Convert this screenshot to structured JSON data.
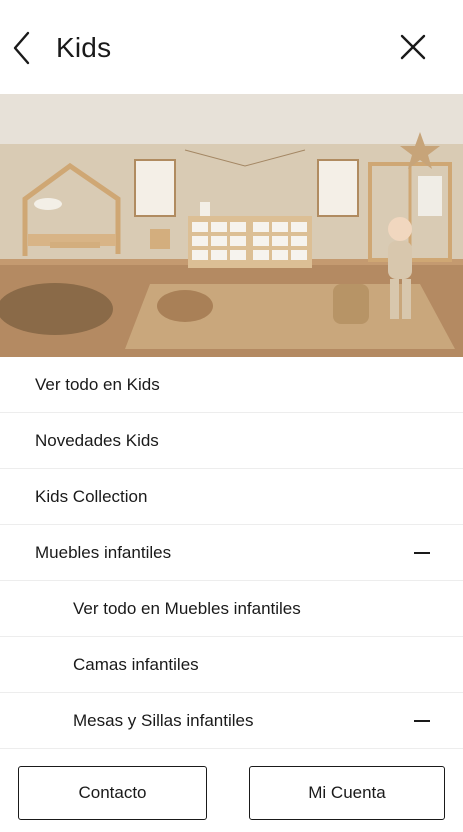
{
  "header": {
    "title": "Kids",
    "back_icon": "chevron-left-icon",
    "close_icon": "close-icon"
  },
  "menu": {
    "items": [
      {
        "label": "Ver todo en Kids",
        "level": 1
      },
      {
        "label": "Novedades Kids",
        "level": 1
      },
      {
        "label": "Kids Collection",
        "level": 1
      },
      {
        "label": "Muebles infantiles",
        "level": 1,
        "toggle": "—"
      },
      {
        "label": "Ver todo en Muebles infantiles",
        "level": 2
      },
      {
        "label": "Camas infantiles",
        "level": 2
      },
      {
        "label": "Mesas y Sillas infantiles",
        "level": 2,
        "toggle": "—"
      }
    ]
  },
  "footer": {
    "contact_label": "Contacto",
    "account_label": "Mi Cuenta"
  }
}
